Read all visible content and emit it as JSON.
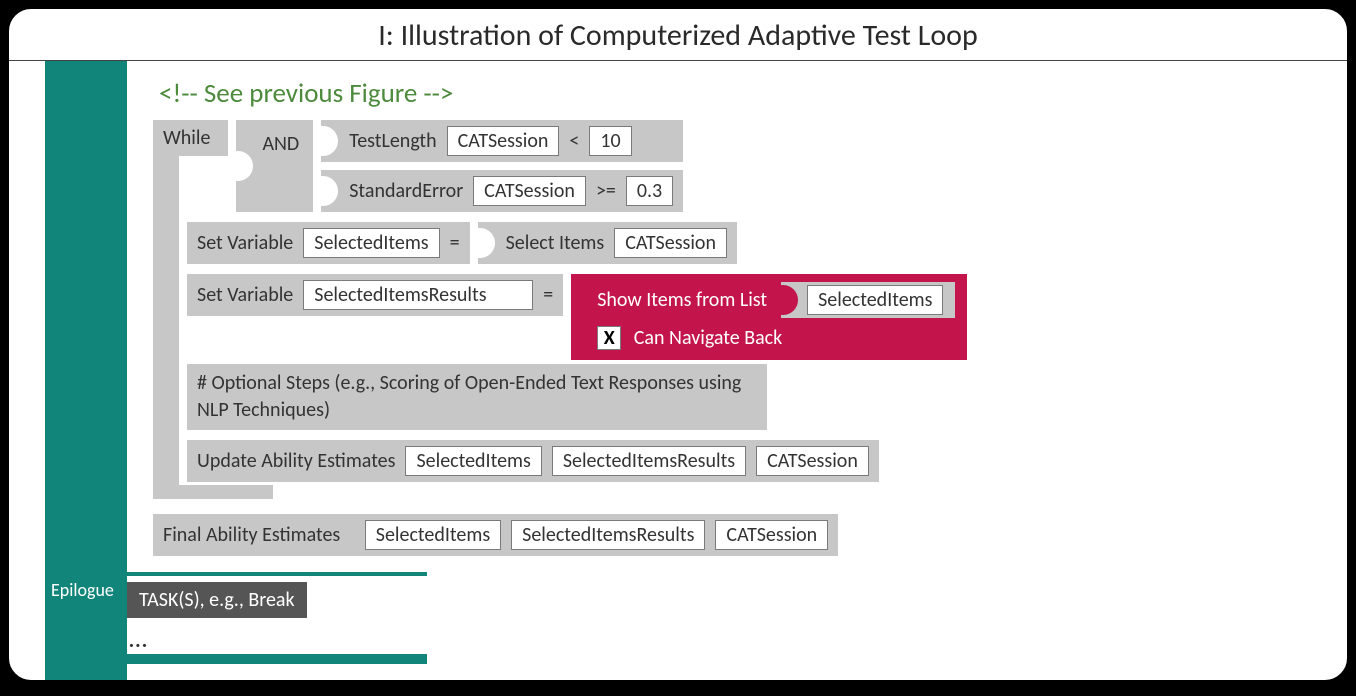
{
  "title": "I: Illustration of Computerized Adaptive Test Loop",
  "comment": "<!-- See previous Figure -->",
  "while": {
    "keyword": "While",
    "and": "AND",
    "cond1": {
      "fn": "TestLength",
      "arg": "CATSession",
      "op": "<",
      "val": "10"
    },
    "cond2": {
      "fn": "StandardError",
      "arg": "CATSession",
      "op": ">=",
      "val": "0.3"
    }
  },
  "set1": {
    "label": "Set Variable",
    "var": "SelectedItems",
    "eq": "=",
    "fn": "Select Items",
    "arg": "CATSession"
  },
  "set2": {
    "label": "Set Variable",
    "var": "SelectedItemsResults",
    "eq": "="
  },
  "show": {
    "label": "Show Items from List",
    "trail_arg": "SelectedItems",
    "check_mark": "X",
    "check_label": "Can Navigate Back"
  },
  "optional": "# Optional Steps (e.g., Scoring of Open-Ended Text Responses using NLP Techniques)",
  "update": {
    "label": "Update Ability Estimates",
    "a": "SelectedItems",
    "b": "SelectedItemsResults",
    "c": "CATSession"
  },
  "final": {
    "label": "Final Ability Estimates",
    "a": "SelectedItems",
    "b": "SelectedItemsResults",
    "c": "CATSession"
  },
  "epilogue": {
    "tab": "Epilogue",
    "task": "TASK(S), e.g., Break",
    "more": "…"
  }
}
